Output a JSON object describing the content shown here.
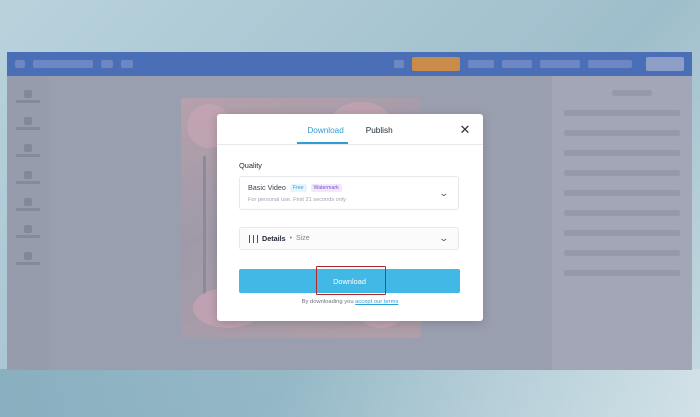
{
  "modal": {
    "tabs": [
      {
        "label": "Download",
        "active": true
      },
      {
        "label": "Publish",
        "active": false
      }
    ],
    "close_icon": "close-icon",
    "quality_label": "Quality",
    "quality_select": {
      "name": "Basic Video",
      "badge_free": "Free",
      "badge_watermark": "Watermark",
      "subtitle": "For personal use. First 21 seconds only"
    },
    "details": {
      "label": "Details",
      "separator": "•",
      "size": "Size"
    },
    "download_button": "Download",
    "legal_prefix": "By downloading you",
    "legal_link": "accept our terms"
  },
  "colors": {
    "accent": "#41b8e5",
    "tab_active": "#2f9fd3",
    "highlight_border": "#b52626"
  }
}
